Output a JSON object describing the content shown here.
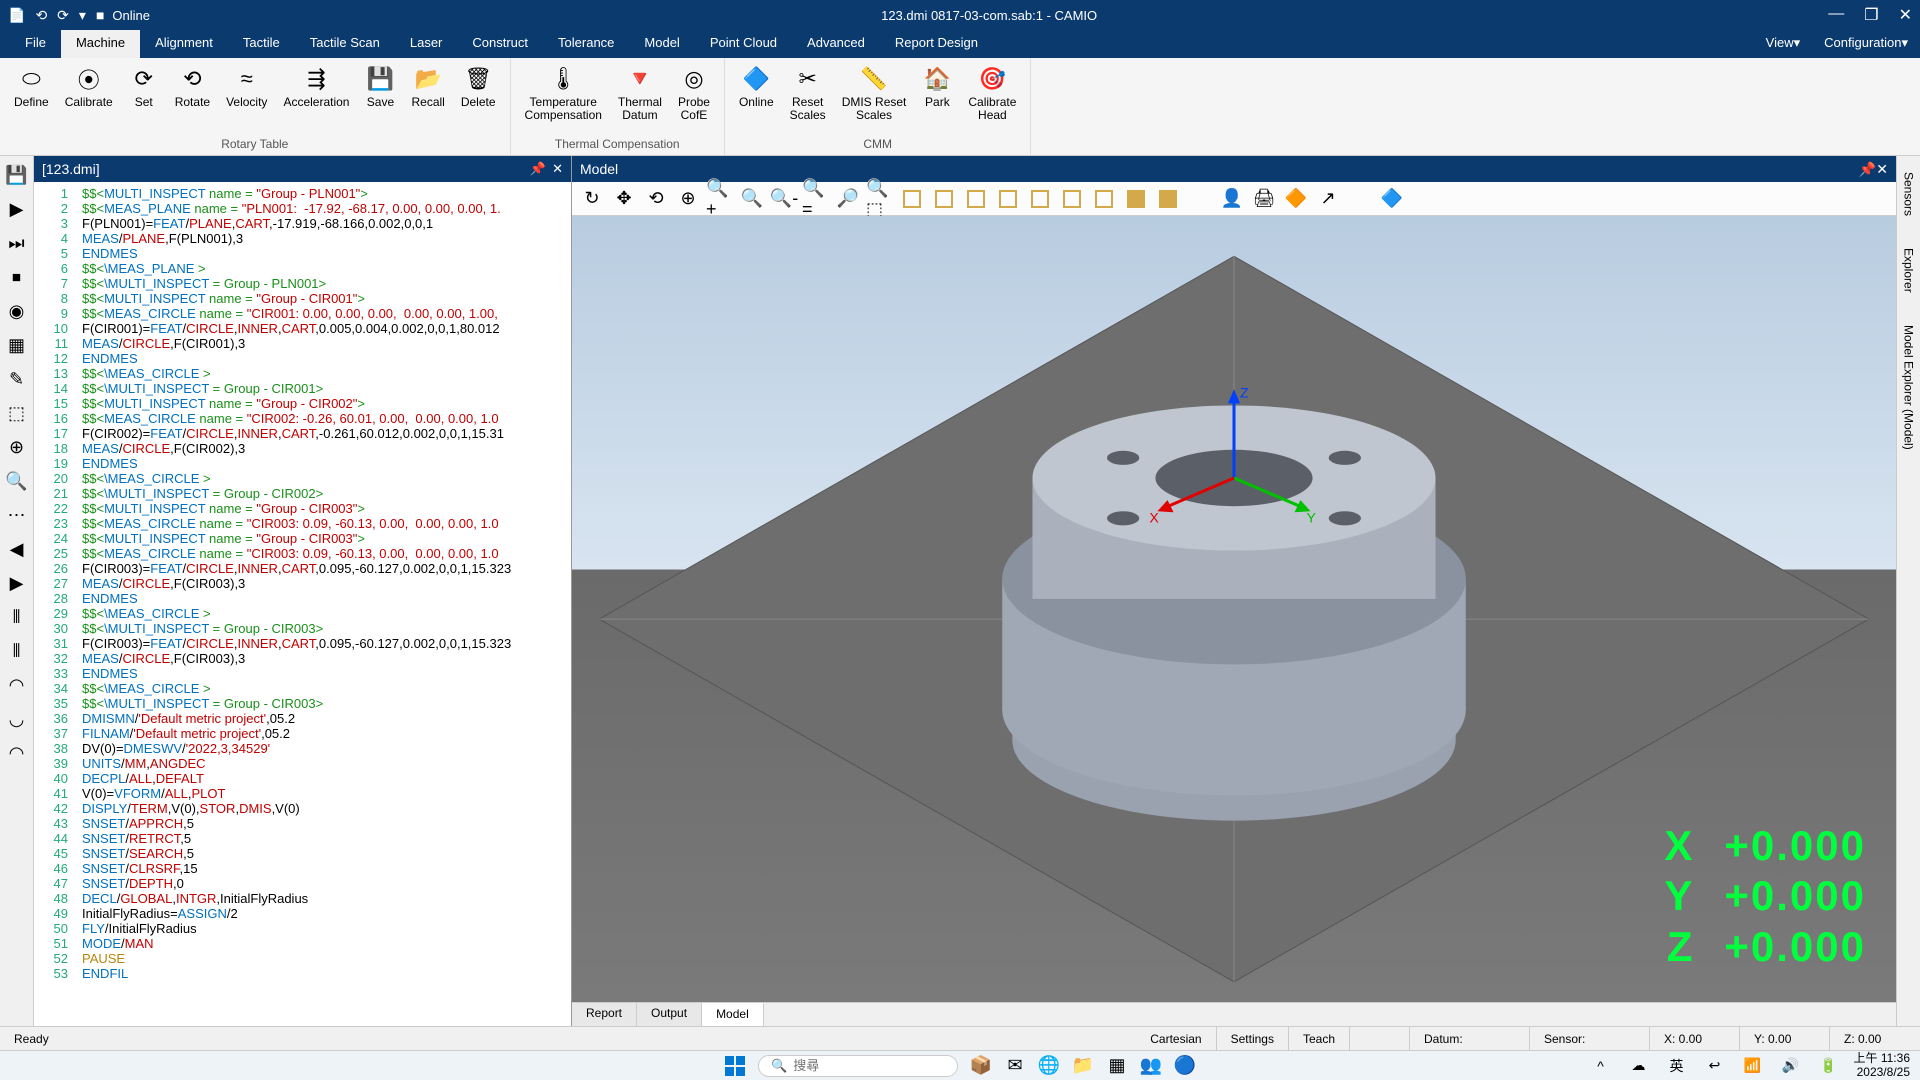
{
  "titlebar": {
    "online": "Online",
    "title": "123.dmi  0817-03-com.sab:1 - CAMIO",
    "min": "—",
    "max": "❐",
    "close": "✕"
  },
  "menutabs": {
    "items": [
      "File",
      "Machine",
      "Alignment",
      "Tactile",
      "Tactile Scan",
      "Laser",
      "Construct",
      "Tolerance",
      "Model",
      "Point Cloud",
      "Advanced",
      "Report Design"
    ],
    "active": 1,
    "right": [
      "View▾",
      "Configuration▾"
    ]
  },
  "ribbon": {
    "groups": [
      {
        "name": "Rotary Table",
        "buttons": [
          {
            "ico": "⬭",
            "lbl": "Define"
          },
          {
            "ico": "⦿",
            "lbl": "Calibrate"
          },
          {
            "ico": "⟳",
            "lbl": "Set"
          },
          {
            "ico": "⟲",
            "lbl": "Rotate"
          },
          {
            "ico": "≈",
            "lbl": "Velocity"
          },
          {
            "ico": "⇶",
            "lbl": "Acceleration"
          },
          {
            "ico": "💾",
            "lbl": "Save"
          },
          {
            "ico": "📂",
            "lbl": "Recall"
          },
          {
            "ico": "🗑",
            "lbl": "Delete"
          }
        ]
      },
      {
        "name": "Thermal Compensation",
        "buttons": [
          {
            "ico": "🌡",
            "lbl": "Temperature\nCompensation"
          },
          {
            "ico": "🔻",
            "lbl": "Thermal\nDatum"
          },
          {
            "ico": "◎",
            "lbl": "Probe\nCofE"
          }
        ]
      },
      {
        "name": "CMM",
        "buttons": [
          {
            "ico": "🔷",
            "lbl": "Online"
          },
          {
            "ico": "✂",
            "lbl": "Reset\nScales"
          },
          {
            "ico": "📏",
            "lbl": "DMIS Reset\nScales"
          },
          {
            "ico": "🏠",
            "lbl": "Park"
          },
          {
            "ico": "🎯",
            "lbl": "Calibrate\nHead"
          }
        ]
      }
    ]
  },
  "lefttools": [
    "💾",
    "▶",
    "⏭",
    "⏹",
    "◉",
    "▦",
    "✎",
    "⬚",
    "⊕",
    "🔍",
    "⋯",
    "◀",
    "▶",
    "⫴",
    "⫴",
    "◠",
    "◡",
    "◠"
  ],
  "codepanel": {
    "title": "[123.dmi]",
    "pin": "📌",
    "close": "✕"
  },
  "codelines": [
    {
      "n": 1,
      "seg": [
        [
          "g",
          "$$<"
        ],
        [
          "b",
          "MULTI_INSPECT"
        ],
        [
          "g",
          " name = "
        ],
        [
          "r",
          "\"Group - PLN001\""
        ],
        [
          "g",
          ">"
        ]
      ]
    },
    {
      "n": 2,
      "seg": [
        [
          "g",
          "$$<"
        ],
        [
          "b",
          "MEAS_PLANE"
        ],
        [
          "g",
          " name = "
        ],
        [
          "r",
          "\"PLN001:  -17.92, -68.17, 0.00, 0.00, 0.00, 1."
        ]
      ]
    },
    {
      "n": 3,
      "seg": [
        [
          "k",
          "F(PLN001)="
        ],
        [
          "b",
          "FEAT"
        ],
        [
          "k",
          "/"
        ],
        [
          "r",
          "PLANE"
        ],
        [
          "k",
          ","
        ],
        [
          "r",
          "CART"
        ],
        [
          "k",
          ",-17.919,-68.166,0.002,0,0,1"
        ]
      ]
    },
    {
      "n": 4,
      "seg": [
        [
          "b",
          "MEAS"
        ],
        [
          "k",
          "/"
        ],
        [
          "r",
          "PLANE"
        ],
        [
          "k",
          ",F(PLN001),3"
        ]
      ]
    },
    {
      "n": 5,
      "seg": [
        [
          "b",
          "ENDMES"
        ]
      ]
    },
    {
      "n": 6,
      "seg": [
        [
          "g",
          "$$<"
        ],
        [
          "b",
          "\\MEAS_PLANE"
        ],
        [
          "g",
          " >"
        ]
      ]
    },
    {
      "n": 7,
      "seg": [
        [
          "g",
          "$$<"
        ],
        [
          "b",
          "\\MULTI_INSPECT"
        ],
        [
          "g",
          " = Group - PLN001>"
        ]
      ]
    },
    {
      "n": 8,
      "seg": [
        [
          "g",
          "$$<"
        ],
        [
          "b",
          "MULTI_INSPECT"
        ],
        [
          "g",
          " name = "
        ],
        [
          "r",
          "\"Group - CIR001\""
        ],
        [
          "g",
          ">"
        ]
      ]
    },
    {
      "n": 9,
      "seg": [
        [
          "g",
          "$$<"
        ],
        [
          "b",
          "MEAS_CIRCLE"
        ],
        [
          "g",
          " name = "
        ],
        [
          "r",
          "\"CIR001: 0.00, 0.00, 0.00,  0.00, 0.00, 1.00,"
        ]
      ]
    },
    {
      "n": 10,
      "seg": [
        [
          "k",
          "F(CIR001)="
        ],
        [
          "b",
          "FEAT"
        ],
        [
          "k",
          "/"
        ],
        [
          "r",
          "CIRCLE"
        ],
        [
          "k",
          ","
        ],
        [
          "r",
          "INNER"
        ],
        [
          "k",
          ","
        ],
        [
          "r",
          "CART"
        ],
        [
          "k",
          ",0.005,0.004,0.002,0,0,1,80.012"
        ]
      ]
    },
    {
      "n": 11,
      "seg": [
        [
          "b",
          "MEAS"
        ],
        [
          "k",
          "/"
        ],
        [
          "r",
          "CIRCLE"
        ],
        [
          "k",
          ",F(CIR001),3"
        ]
      ]
    },
    {
      "n": 12,
      "seg": [
        [
          "b",
          "ENDMES"
        ]
      ]
    },
    {
      "n": 13,
      "seg": [
        [
          "g",
          "$$<"
        ],
        [
          "b",
          "\\MEAS_CIRCLE"
        ],
        [
          "g",
          " >"
        ]
      ]
    },
    {
      "n": 14,
      "seg": [
        [
          "g",
          "$$<"
        ],
        [
          "b",
          "\\MULTI_INSPECT"
        ],
        [
          "g",
          " = Group - CIR001>"
        ]
      ]
    },
    {
      "n": 15,
      "seg": [
        [
          "g",
          "$$<"
        ],
        [
          "b",
          "MULTI_INSPECT"
        ],
        [
          "g",
          " name = "
        ],
        [
          "r",
          "\"Group - CIR002\""
        ],
        [
          "g",
          ">"
        ]
      ]
    },
    {
      "n": 16,
      "seg": [
        [
          "g",
          "$$<"
        ],
        [
          "b",
          "MEAS_CIRCLE"
        ],
        [
          "g",
          " name = "
        ],
        [
          "r",
          "\"CIR002: -0.26, 60.01, 0.00,  0.00, 0.00, 1.0"
        ]
      ]
    },
    {
      "n": 17,
      "seg": [
        [
          "k",
          "F(CIR002)="
        ],
        [
          "b",
          "FEAT"
        ],
        [
          "k",
          "/"
        ],
        [
          "r",
          "CIRCLE"
        ],
        [
          "k",
          ","
        ],
        [
          "r",
          "INNER"
        ],
        [
          "k",
          ","
        ],
        [
          "r",
          "CART"
        ],
        [
          "k",
          ",-0.261,60.012,0.002,0,0,1,15.31"
        ]
      ]
    },
    {
      "n": 18,
      "seg": [
        [
          "b",
          "MEAS"
        ],
        [
          "k",
          "/"
        ],
        [
          "r",
          "CIRCLE"
        ],
        [
          "k",
          ",F(CIR002),3"
        ]
      ]
    },
    {
      "n": 19,
      "seg": [
        [
          "b",
          "ENDMES"
        ]
      ]
    },
    {
      "n": 20,
      "seg": [
        [
          "g",
          "$$<"
        ],
        [
          "b",
          "\\MEAS_CIRCLE"
        ],
        [
          "g",
          " >"
        ]
      ]
    },
    {
      "n": 21,
      "seg": [
        [
          "g",
          "$$<"
        ],
        [
          "b",
          "\\MULTI_INSPECT"
        ],
        [
          "g",
          " = Group - CIR002>"
        ]
      ]
    },
    {
      "n": 22,
      "seg": [
        [
          "g",
          "$$<"
        ],
        [
          "b",
          "MULTI_INSPECT"
        ],
        [
          "g",
          " name = "
        ],
        [
          "r",
          "\"Group - CIR003\""
        ],
        [
          "g",
          ">"
        ]
      ]
    },
    {
      "n": 23,
      "seg": [
        [
          "g",
          "$$<"
        ],
        [
          "b",
          "MEAS_CIRCLE"
        ],
        [
          "g",
          " name = "
        ],
        [
          "r",
          "\"CIR003: 0.09, -60.13, 0.00,  0.00, 0.00, 1.0"
        ]
      ]
    },
    {
      "n": 24,
      "seg": [
        [
          "g",
          "$$<"
        ],
        [
          "b",
          "MULTI_INSPECT"
        ],
        [
          "g",
          " name = "
        ],
        [
          "r",
          "\"Group - CIR003\""
        ],
        [
          "g",
          ">"
        ]
      ]
    },
    {
      "n": 25,
      "seg": [
        [
          "g",
          "$$<"
        ],
        [
          "b",
          "MEAS_CIRCLE"
        ],
        [
          "g",
          " name = "
        ],
        [
          "r",
          "\"CIR003: 0.09, -60.13, 0.00,  0.00, 0.00, 1.0"
        ]
      ]
    },
    {
      "n": 26,
      "seg": [
        [
          "k",
          "F(CIR003)="
        ],
        [
          "b",
          "FEAT"
        ],
        [
          "k",
          "/"
        ],
        [
          "r",
          "CIRCLE"
        ],
        [
          "k",
          ","
        ],
        [
          "r",
          "INNER"
        ],
        [
          "k",
          ","
        ],
        [
          "r",
          "CART"
        ],
        [
          "k",
          ",0.095,-60.127,0.002,0,0,1,15.323"
        ]
      ]
    },
    {
      "n": 27,
      "seg": [
        [
          "b",
          "MEAS"
        ],
        [
          "k",
          "/"
        ],
        [
          "r",
          "CIRCLE"
        ],
        [
          "k",
          ",F(CIR003),3"
        ]
      ]
    },
    {
      "n": 28,
      "seg": [
        [
          "b",
          "ENDMES"
        ]
      ]
    },
    {
      "n": 29,
      "seg": [
        [
          "g",
          "$$<"
        ],
        [
          "b",
          "\\MEAS_CIRCLE"
        ],
        [
          "g",
          " >"
        ]
      ]
    },
    {
      "n": 30,
      "seg": [
        [
          "g",
          "$$<"
        ],
        [
          "b",
          "\\MULTI_INSPECT"
        ],
        [
          "g",
          " = Group - CIR003>"
        ]
      ]
    },
    {
      "n": 31,
      "seg": [
        [
          "k",
          "F(CIR003)="
        ],
        [
          "b",
          "FEAT"
        ],
        [
          "k",
          "/"
        ],
        [
          "r",
          "CIRCLE"
        ],
        [
          "k",
          ","
        ],
        [
          "r",
          "INNER"
        ],
        [
          "k",
          ","
        ],
        [
          "r",
          "CART"
        ],
        [
          "k",
          ",0.095,-60.127,0.002,0,0,1,15.323"
        ]
      ]
    },
    {
      "n": 32,
      "seg": [
        [
          "b",
          "MEAS"
        ],
        [
          "k",
          "/"
        ],
        [
          "r",
          "CIRCLE"
        ],
        [
          "k",
          ",F(CIR003),3"
        ]
      ]
    },
    {
      "n": 33,
      "seg": [
        [
          "b",
          "ENDMES"
        ]
      ]
    },
    {
      "n": 34,
      "seg": [
        [
          "g",
          "$$<"
        ],
        [
          "b",
          "\\MEAS_CIRCLE"
        ],
        [
          "g",
          " >"
        ]
      ]
    },
    {
      "n": 35,
      "seg": [
        [
          "g",
          "$$<"
        ],
        [
          "b",
          "\\MULTI_INSPECT"
        ],
        [
          "g",
          " = Group - CIR003>"
        ]
      ]
    },
    {
      "n": 36,
      "seg": [
        [
          "b",
          "DMISMN"
        ],
        [
          "k",
          "/"
        ],
        [
          "r",
          "'Default metric project'"
        ],
        [
          "k",
          ",05.2"
        ]
      ]
    },
    {
      "n": 37,
      "seg": [
        [
          "b",
          "FILNAM"
        ],
        [
          "k",
          "/"
        ],
        [
          "r",
          "'Default metric project'"
        ],
        [
          "k",
          ",05.2"
        ]
      ]
    },
    {
      "n": 38,
      "seg": [
        [
          "k",
          "DV(0)="
        ],
        [
          "b",
          "DMESWV"
        ],
        [
          "k",
          "/"
        ],
        [
          "r",
          "'2022,3,34529'"
        ]
      ]
    },
    {
      "n": 39,
      "seg": [
        [
          "b",
          "UNITS"
        ],
        [
          "k",
          "/"
        ],
        [
          "r",
          "MM"
        ],
        [
          "k",
          ","
        ],
        [
          "r",
          "ANGDEC"
        ]
      ]
    },
    {
      "n": 40,
      "seg": [
        [
          "b",
          "DECPL"
        ],
        [
          "k",
          "/"
        ],
        [
          "r",
          "ALL"
        ],
        [
          "k",
          ","
        ],
        [
          "r",
          "DEFALT"
        ]
      ]
    },
    {
      "n": 41,
      "seg": [
        [
          "k",
          "V(0)="
        ],
        [
          "b",
          "VFORM"
        ],
        [
          "k",
          "/"
        ],
        [
          "r",
          "ALL"
        ],
        [
          "k",
          ","
        ],
        [
          "r",
          "PLOT"
        ]
      ]
    },
    {
      "n": 42,
      "seg": [
        [
          "b",
          "DISPLY"
        ],
        [
          "k",
          "/"
        ],
        [
          "r",
          "TERM"
        ],
        [
          "k",
          ",V(0),"
        ],
        [
          "r",
          "STOR"
        ],
        [
          "k",
          ","
        ],
        [
          "r",
          "DMIS"
        ],
        [
          "k",
          ",V(0)"
        ]
      ]
    },
    {
      "n": 43,
      "seg": [
        [
          "b",
          "SNSET"
        ],
        [
          "k",
          "/"
        ],
        [
          "r",
          "APPRCH"
        ],
        [
          "k",
          ",5"
        ]
      ]
    },
    {
      "n": 44,
      "seg": [
        [
          "b",
          "SNSET"
        ],
        [
          "k",
          "/"
        ],
        [
          "r",
          "RETRCT"
        ],
        [
          "k",
          ",5"
        ]
      ]
    },
    {
      "n": 45,
      "seg": [
        [
          "b",
          "SNSET"
        ],
        [
          "k",
          "/"
        ],
        [
          "r",
          "SEARCH"
        ],
        [
          "k",
          ",5"
        ]
      ]
    },
    {
      "n": 46,
      "seg": [
        [
          "b",
          "SNSET"
        ],
        [
          "k",
          "/"
        ],
        [
          "r",
          "CLRSRF"
        ],
        [
          "k",
          ",15"
        ]
      ]
    },
    {
      "n": 47,
      "seg": [
        [
          "b",
          "SNSET"
        ],
        [
          "k",
          "/"
        ],
        [
          "r",
          "DEPTH"
        ],
        [
          "k",
          ",0"
        ]
      ]
    },
    {
      "n": 48,
      "seg": [
        [
          "b",
          "DECL"
        ],
        [
          "k",
          "/"
        ],
        [
          "r",
          "GLOBAL"
        ],
        [
          "k",
          ","
        ],
        [
          "r",
          "INTGR"
        ],
        [
          "k",
          ",InitialFlyRadius"
        ]
      ]
    },
    {
      "n": 49,
      "seg": [
        [
          "k",
          "InitialFlyRadius="
        ],
        [
          "b",
          "ASSIGN"
        ],
        [
          "k",
          "/2"
        ]
      ]
    },
    {
      "n": 50,
      "seg": [
        [
          "b",
          "FLY"
        ],
        [
          "k",
          "/InitialFlyRadius"
        ]
      ]
    },
    {
      "n": 51,
      "seg": [
        [
          "b",
          "MODE"
        ],
        [
          "k",
          "/"
        ],
        [
          "r",
          "MAN"
        ]
      ]
    },
    {
      "n": 52,
      "seg": [
        [
          "o",
          "PAUSE"
        ]
      ]
    },
    {
      "n": 53,
      "seg": [
        [
          "b",
          "ENDFIL"
        ]
      ]
    }
  ],
  "modelpanel": {
    "title": "Model",
    "pin": "📌",
    "close": "✕",
    "toolbar_icons": [
      "↻",
      "✥",
      "⟲",
      "⊕",
      "🔍+",
      "🔍",
      "🔍-",
      "🔍=",
      "🔎",
      "🔍⬚",
      "⬚",
      "⬚",
      "⬚",
      "⬚",
      "⬚",
      "⬚",
      "⬚",
      "⬛",
      "⬛",
      "",
      "👤",
      "🖨",
      "🔶",
      "↗",
      "",
      "🔷"
    ],
    "tabs": [
      "Report",
      "Output",
      "Model"
    ],
    "active_tab": 2
  },
  "coords": {
    "x_label": "X",
    "x_val": "+0.000",
    "y_label": "Y",
    "y_val": "+0.000",
    "z_label": "Z",
    "z_val": "+0.000"
  },
  "rightside": [
    "Sensors",
    "Explorer",
    "Model Explorer (Model)"
  ],
  "statusbar": {
    "ready": "Ready",
    "cartesian": "Cartesian",
    "settings": "Settings",
    "teach": "Teach",
    "datum": "Datum:",
    "sensor": "Sensor:",
    "x": "X: 0.00",
    "y": "Y: 0.00",
    "z": "Z: 0.00"
  },
  "taskbar": {
    "search_ico": "🔍",
    "search_ph": "搜尋",
    "apps": [
      "📦",
      "✉",
      "🌐",
      "📁",
      "▦",
      "👥",
      "🔵"
    ],
    "tray": [
      "^",
      "☁",
      "英",
      "↩",
      "📶",
      "🔊",
      "🔋"
    ],
    "time": "上午 11:36",
    "date": "2023/8/25"
  }
}
